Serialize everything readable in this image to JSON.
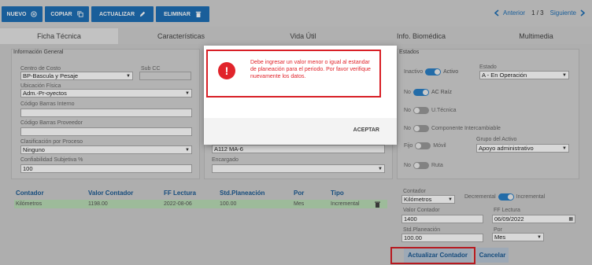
{
  "toolbar": {
    "nuevo": "NUEVO",
    "copiar": "COPIAR",
    "actualizar": "ACTUALIZAR",
    "eliminar": "ELIMINAR"
  },
  "pager": {
    "anterior": "Anterior",
    "pos": "1 / 3",
    "siguiente": "Siguiente"
  },
  "tabs": [
    "Ficha Técnica",
    "Características",
    "Vida Útil",
    "Info. Biomédica",
    "Multimedia"
  ],
  "info": {
    "title": "Información General",
    "centro_costo_label": "Centro de Costo",
    "centro_costo": "BP-Bascula y Pesaje",
    "sub_cc_label": "Sub CC",
    "ubicacion_label": "Ubicación Física",
    "ubicacion": "Adm.-Pr-oyectos",
    "barras_interno_label": "Código Barras Interno",
    "barras_proveedor_label": "Código Barras Proveedor",
    "clasificacion_label": "Clasificación por Proceso",
    "clasificacion": "Ninguno",
    "confiabilidad_label": "Confiabilidad Subjetiva %",
    "confiabilidad": "100"
  },
  "middle": {
    "field_value": "A112 MA-6",
    "encargado_label": "Encargado"
  },
  "estados": {
    "title": "Estados",
    "inactivo": "Inactivo",
    "activo": "Activo",
    "estado_label": "Estado",
    "estado": "A - En Operación",
    "no": "No",
    "ac_raiz": "AC Raíz",
    "u_tecnica": "U.Técnica",
    "componente": "Componente Intercambiable",
    "fijo": "Fijo",
    "movil": "Móvil",
    "grupo_label": "Grupo del Activo",
    "grupo": "Apoyo administrativo",
    "ruta": "Ruta"
  },
  "table": {
    "headers": [
      "Contador",
      "Valor Contador",
      "FF Lectura",
      "Std.Planeación",
      "Por",
      "Tipo"
    ],
    "rows": [
      [
        "Kilómetros",
        "1198.00",
        "2022-08-06",
        "100.00",
        "Mes",
        "Incremental"
      ]
    ]
  },
  "contador_form": {
    "contador_label": "Contador",
    "contador": "Kilómetros",
    "decremental": "Decremental",
    "incremental": "Incremental",
    "valor_label": "Valor Contador",
    "valor": "1400",
    "ff_label": "FF Lectura",
    "ff": "06/09/2022",
    "std_label": "Std.Planeación",
    "std": "100.00",
    "por_label": "Por",
    "por": "Mes",
    "actualizar": "Actualizar Contador",
    "cancelar": "Cancelar"
  },
  "dialog": {
    "message": "Debe ingresar un valor menor o igual al estandar de planeación para el periodo. Por favor verifique nuevamente los datos.",
    "aceptar": "ACEPTAR"
  }
}
